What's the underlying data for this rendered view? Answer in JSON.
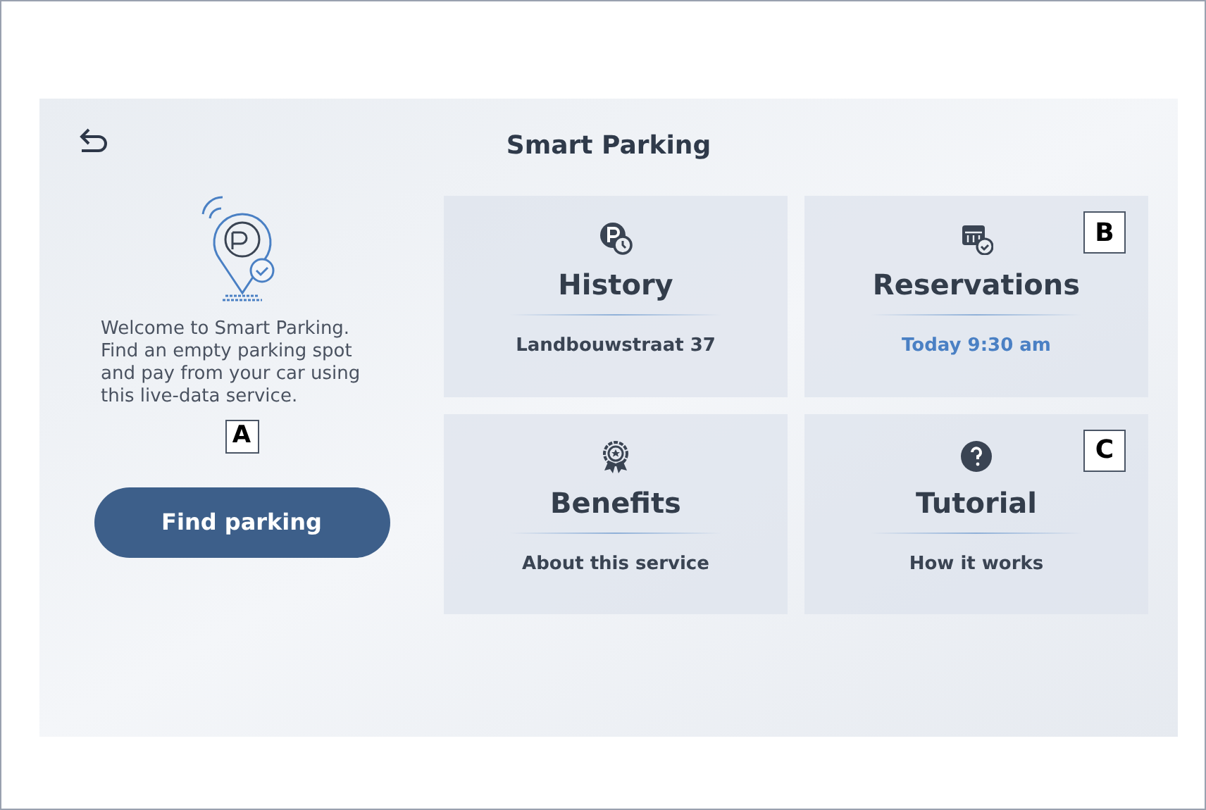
{
  "header": {
    "title": "Smart Parking"
  },
  "intro": {
    "text": "Welcome to Smart Parking. Find an empty parking spot and pay from your car using this live-data service.",
    "callout": "A",
    "button": "Find parking"
  },
  "tiles": [
    {
      "kind": "history",
      "title": "History",
      "subtitle": "Landbouwstraat 37",
      "accent": false
    },
    {
      "kind": "reservations",
      "title": "Reservations",
      "subtitle": "Today 9:30 am",
      "accent": true,
      "callout": "B"
    },
    {
      "kind": "benefits",
      "title": "Benefits",
      "subtitle": "About this service",
      "accent": false
    },
    {
      "kind": "tutorial",
      "title": "Tutorial",
      "subtitle": "How it works",
      "accent": false,
      "callout": "C"
    }
  ]
}
